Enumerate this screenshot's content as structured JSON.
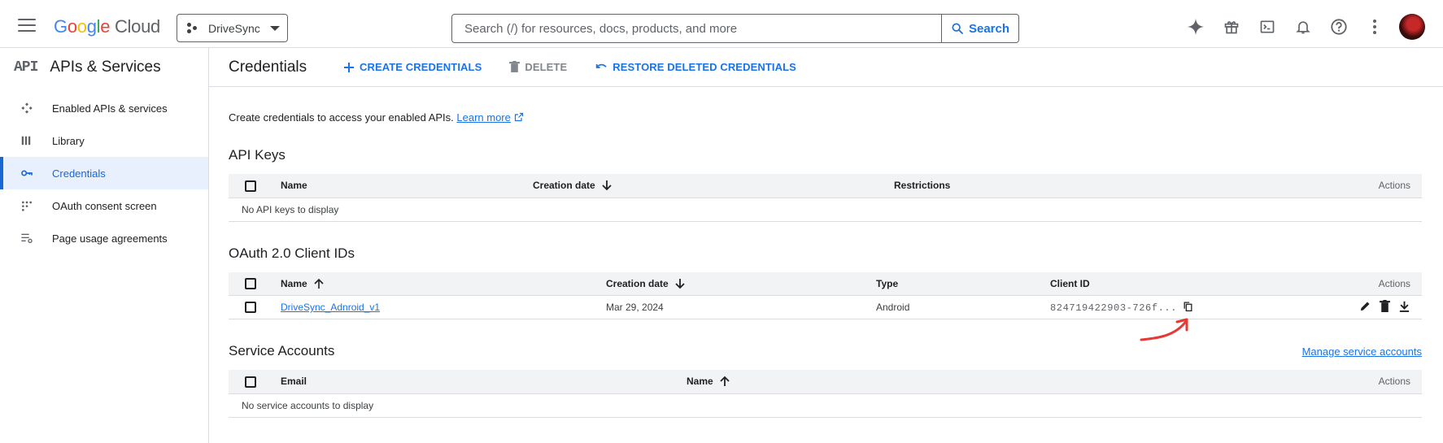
{
  "header": {
    "logo_google": [
      "G",
      "o",
      "o",
      "g",
      "l",
      "e"
    ],
    "logo_cloud": "Cloud",
    "project_name": "DriveSync",
    "search_placeholder": "Search (/) for resources, docs, products, and more",
    "search_button": "Search"
  },
  "sidebar": {
    "api_mark": "API",
    "title": "APIs & Services",
    "items": [
      {
        "label": "Enabled APIs & services",
        "icon": "services-icon"
      },
      {
        "label": "Library",
        "icon": "library-icon"
      },
      {
        "label": "Credentials",
        "icon": "key-icon",
        "active": true
      },
      {
        "label": "OAuth consent screen",
        "icon": "oauth-icon"
      },
      {
        "label": "Page usage agreements",
        "icon": "settings-list-icon"
      }
    ]
  },
  "toolbar": {
    "title": "Credentials",
    "create_label": "CREATE CREDENTIALS",
    "delete_label": "DELETE",
    "restore_label": "RESTORE DELETED CREDENTIALS"
  },
  "intro": {
    "text": "Create credentials to access your enabled APIs.",
    "learn_more": "Learn more"
  },
  "api_keys": {
    "title": "API Keys",
    "columns": [
      "Name",
      "Creation date",
      "Restrictions",
      "Actions"
    ],
    "empty": "No API keys to display"
  },
  "oauth": {
    "title": "OAuth 2.0 Client IDs",
    "columns": [
      "Name",
      "Creation date",
      "Type",
      "Client ID",
      "Actions"
    ],
    "rows": [
      {
        "name": "DriveSync_Adnroid_v1",
        "date": "Mar 29, 2024",
        "type": "Android",
        "client_id": "824719422903-726f..."
      }
    ]
  },
  "service_accounts": {
    "title": "Service Accounts",
    "manage": "Manage service accounts",
    "columns": [
      "Email",
      "Name",
      "Actions"
    ],
    "empty": "No service accounts to display"
  },
  "colors": {
    "accent": "#1a73e8",
    "annotation": "#e53935"
  }
}
